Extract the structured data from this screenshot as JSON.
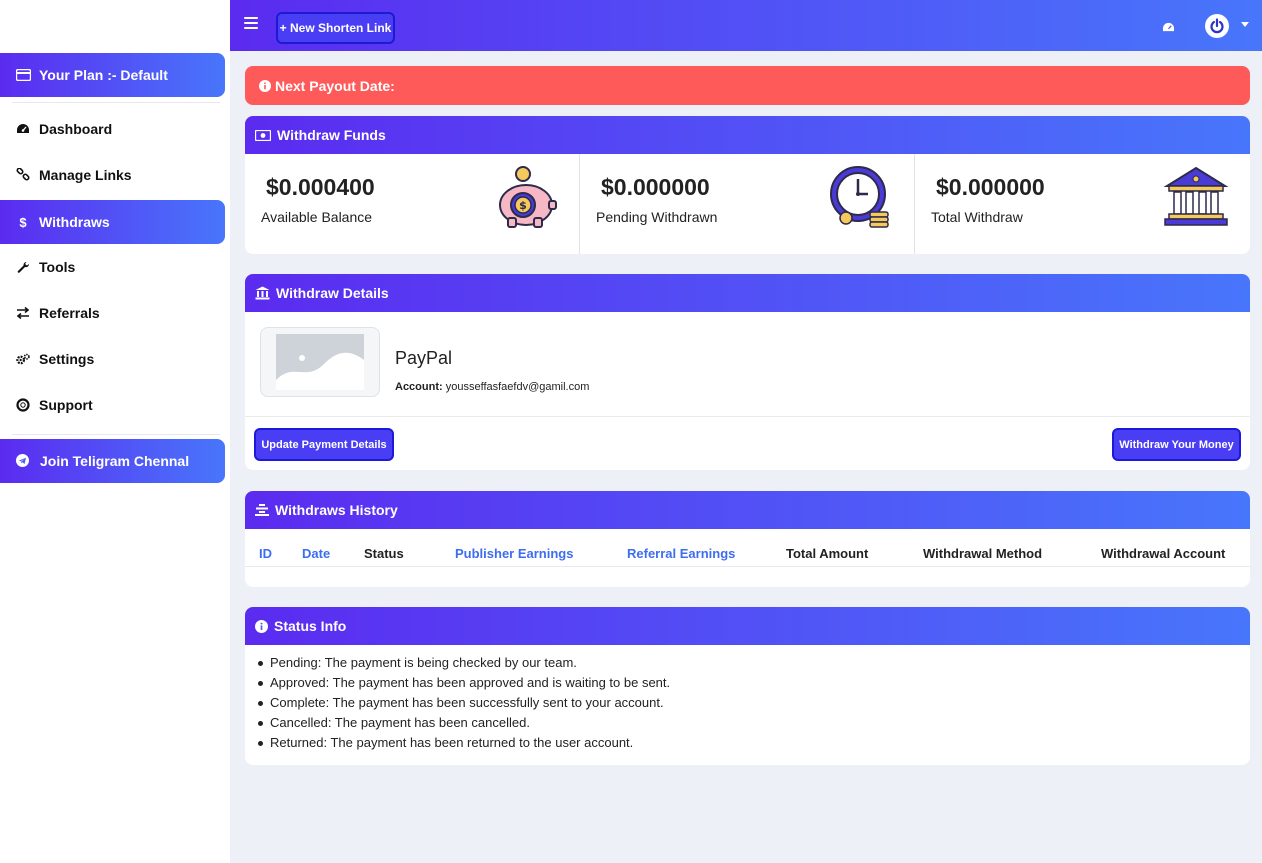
{
  "sidebar": {
    "plan_label": "Your Plan :- Default",
    "items": [
      {
        "label": "Dashboard",
        "icon": "dashboard-icon"
      },
      {
        "label": "Manage Links",
        "icon": "link-icon"
      },
      {
        "label": "Withdraws",
        "icon": "dollar-icon",
        "active": true
      },
      {
        "label": "Tools",
        "icon": "wrench-icon"
      },
      {
        "label": "Referrals",
        "icon": "exchange-icon"
      },
      {
        "label": "Settings",
        "icon": "gears-icon"
      },
      {
        "label": "Support",
        "icon": "life-ring-icon"
      }
    ],
    "telegram_label": "Join Teligram Chennal"
  },
  "topbar": {
    "new_link_label": "+ New Shorten Link"
  },
  "alert": {
    "text": "Next Payout Date:"
  },
  "withdraw_funds": {
    "title": "Withdraw Funds",
    "stats": [
      {
        "amount": "$0.000400",
        "label": "Available Balance",
        "icon": "piggy-bank-icon"
      },
      {
        "amount": "$0.000000",
        "label": "Pending Withdrawn",
        "icon": "clock-coins-icon"
      },
      {
        "amount": "$0.000000",
        "label": "Total Withdraw",
        "icon": "bank-building-icon"
      }
    ]
  },
  "withdraw_details": {
    "title": "Withdraw Details",
    "method": "PayPal",
    "account_label": "Account:",
    "account_value": "youssef​fasfaefdv@gamil.com",
    "update_button": "Update Payment Details",
    "withdraw_button": "Withdraw Your Money"
  },
  "history": {
    "title": "Withdraws History",
    "columns": [
      "ID",
      "Date",
      "Status",
      "Publisher Earnings",
      "Referral Earnings",
      "Total Amount",
      "Withdrawal Method",
      "Withdrawal Account"
    ]
  },
  "status_info": {
    "title": "Status Info",
    "items": [
      "Pending: The payment is being checked by our team.",
      "Approved: The payment has been approved and is waiting to be sent.",
      "Complete: The payment has been successfully sent to your account.",
      "Cancelled: The payment has been cancelled.",
      "Returned: The payment has been returned to the user account."
    ]
  },
  "colors": {
    "gradient_start": "#5b2bf0",
    "gradient_end": "#4876fb",
    "alert_red": "#fe5a5a",
    "link_blue": "#3d6ef0"
  }
}
